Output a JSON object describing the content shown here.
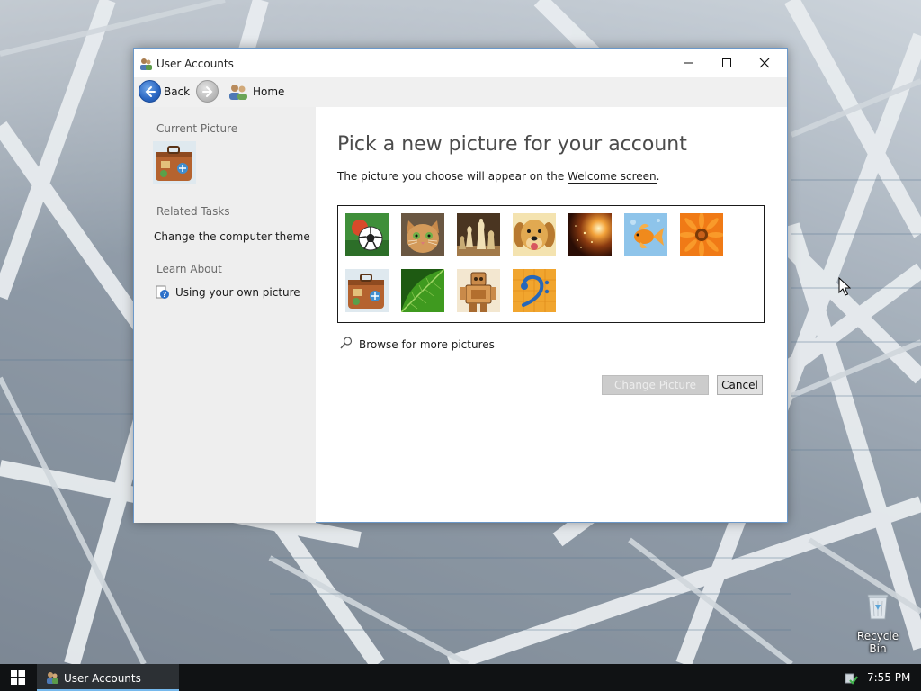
{
  "window": {
    "title": "User Accounts",
    "controls": {
      "minimize": "—",
      "maximize": "☐",
      "close": "✕"
    }
  },
  "navbar": {
    "back_label": "Back",
    "home_label": "Home"
  },
  "sidebar": {
    "current_picture_heading": "Current Picture",
    "related_tasks_heading": "Related Tasks",
    "related_tasks": [
      {
        "label": "Change the computer theme"
      }
    ],
    "learn_about_heading": "Learn About",
    "learn_about": [
      {
        "label": "Using your own picture",
        "icon": "help-icon"
      }
    ]
  },
  "main": {
    "title": "Pick a new picture for your account",
    "subtitle_prefix": "The picture you choose will appear on the ",
    "subtitle_link": "Welcome screen",
    "subtitle_suffix": ".",
    "pictures": [
      {
        "name": "soccer-ball"
      },
      {
        "name": "kitten"
      },
      {
        "name": "chess-pieces"
      },
      {
        "name": "puppy"
      },
      {
        "name": "sparkles"
      },
      {
        "name": "goldfish"
      },
      {
        "name": "orange-flower"
      },
      {
        "name": "suitcase"
      },
      {
        "name": "green-leaf"
      },
      {
        "name": "robot"
      },
      {
        "name": "bass-clef"
      }
    ],
    "browse_label": "Browse for more pictures",
    "change_picture_button": "Change Picture",
    "cancel_button": "Cancel"
  },
  "desktop": {
    "recycle_bin_label": "Recycle Bin"
  },
  "taskbar": {
    "task_label": "User Accounts",
    "clock": "7:55 PM"
  }
}
